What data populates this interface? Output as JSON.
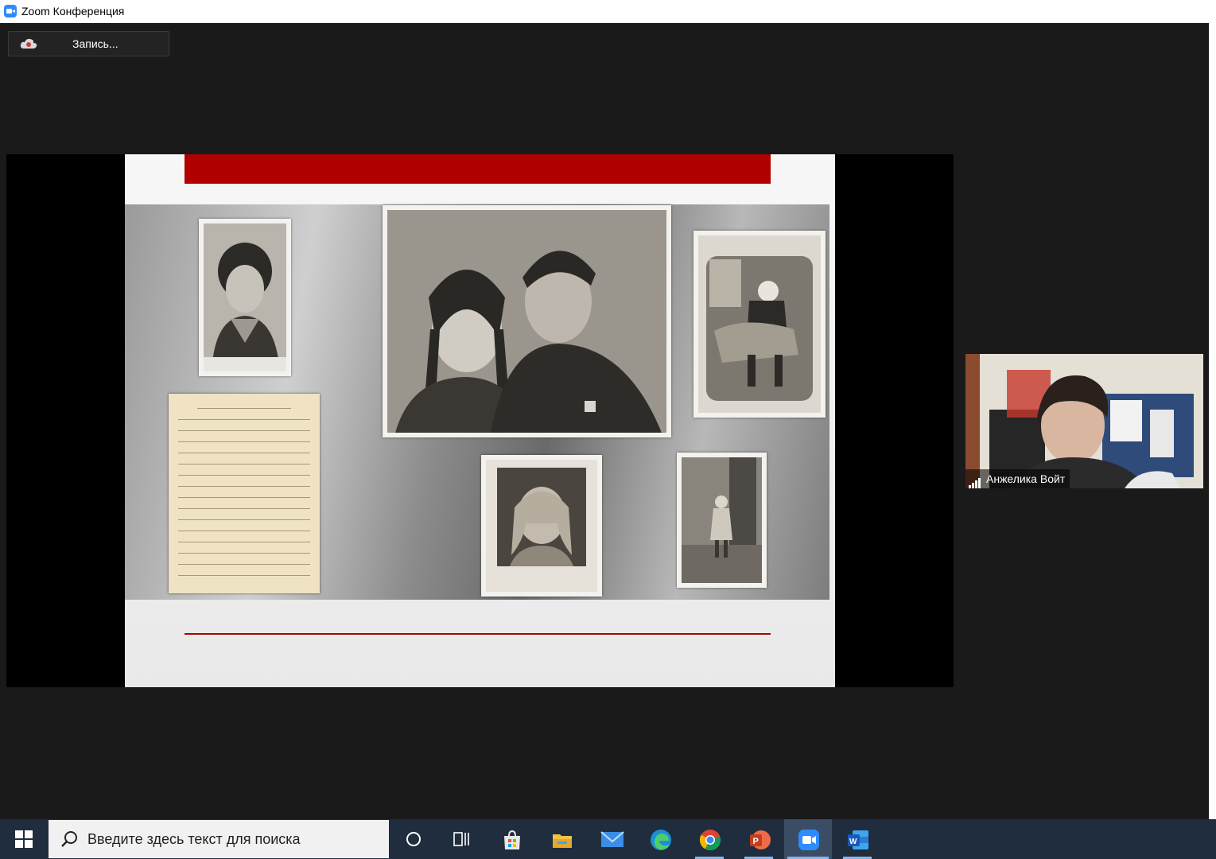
{
  "window": {
    "title": "Zoom Конференция"
  },
  "toolbar": {
    "record_label": "Запись..."
  },
  "participant": {
    "name": "Анжелика Войт"
  },
  "taskbar": {
    "search_placeholder": "Введите здесь текст для поиска",
    "apps": [
      "cortana-icon",
      "task-view-icon",
      "store-icon",
      "file-explorer-icon",
      "mail-icon",
      "edge-icon",
      "chrome-icon",
      "powerpoint-icon",
      "zoom-icon",
      "word-icon"
    ]
  },
  "colors": {
    "accent_red": "#b00000",
    "zoom_blue": "#2d8cff",
    "taskbar": "#1f2d3f"
  }
}
